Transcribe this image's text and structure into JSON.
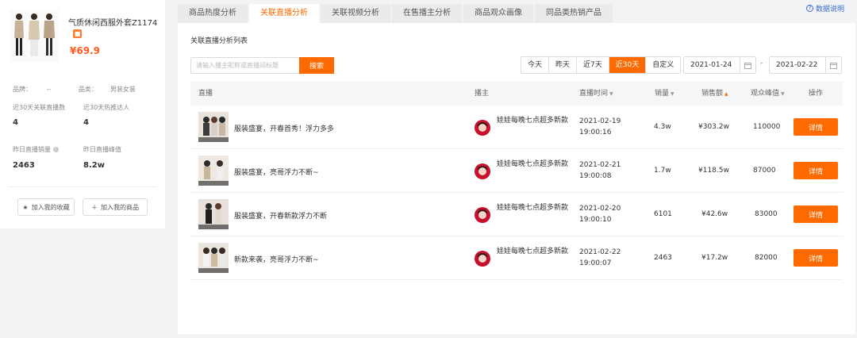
{
  "product": {
    "title": "气质休闲西服外套Z1174",
    "price": "¥69.9",
    "brand_label": "品牌：",
    "brand_value": "--",
    "category_label": "品类：",
    "category_value": "男装女装",
    "stats": [
      {
        "label": "近30天关联直播数",
        "value": "4"
      },
      {
        "label": "近30天热推达人",
        "value": "4"
      },
      {
        "label": "昨日直播销量",
        "value": "2463"
      },
      {
        "label": "昨日直播峰值",
        "value": "8.2w"
      }
    ],
    "favorite_label": "加入我的收藏",
    "add_product_label": "加入我的商品"
  },
  "tabs": [
    {
      "label": "商品热度分析",
      "active": false
    },
    {
      "label": "关联直播分析",
      "active": true
    },
    {
      "label": "关联视频分析",
      "active": false
    },
    {
      "label": "在售播主分析",
      "active": false
    },
    {
      "label": "商品观众画像",
      "active": false
    },
    {
      "label": "同品类热销产品",
      "active": false
    }
  ],
  "help_label": "数据说明",
  "section_title": "关联直播分析列表",
  "search": {
    "placeholder": "请输入播主昵称或直播间标题",
    "button": "搜索"
  },
  "ranges": [
    {
      "label": "今天",
      "active": false
    },
    {
      "label": "昨天",
      "active": false
    },
    {
      "label": "近7天",
      "active": false
    },
    {
      "label": "近30天",
      "active": true
    },
    {
      "label": "自定义",
      "active": false
    }
  ],
  "date_from": "2021-01-24",
  "date_to": "2021-02-22",
  "date_separator": "-",
  "columns": {
    "live": "直播",
    "anchor": "播主",
    "time": "直播时间",
    "sales": "销量",
    "revenue": "销售额",
    "peak": "观众峰值",
    "action": "操作"
  },
  "rows": [
    {
      "title": "服装盛宴，开春首秀！浮力多多",
      "anchor": "娃娃每晚七点超多新款",
      "date": "2021-02-19",
      "time": "19:00:16",
      "sales": "4.3w",
      "revenue": "¥303.2w",
      "peak": "110000",
      "action": "详情"
    },
    {
      "title": "服装盛宴，亮哥浮力不断~",
      "anchor": "娃娃每晚七点超多新款",
      "date": "2021-02-21",
      "time": "19:00:08",
      "sales": "1.7w",
      "revenue": "¥118.5w",
      "peak": "87000",
      "action": "详情"
    },
    {
      "title": "服装盛宴，开春新款浮力不断",
      "anchor": "娃娃每晚七点超多新款",
      "date": "2021-02-20",
      "time": "19:00:10",
      "sales": "6101",
      "revenue": "¥42.6w",
      "peak": "83000",
      "action": "详情"
    },
    {
      "title": "新款来袭，亮哥浮力不断~",
      "anchor": "娃娃每晚七点超多新款",
      "date": "2021-02-22",
      "time": "19:00:07",
      "sales": "2463",
      "revenue": "¥17.2w",
      "peak": "82000",
      "action": "详情"
    }
  ],
  "colors": {
    "accent": "#ff6a00",
    "price": "#ff5a1f",
    "link": "#3b6ccf"
  }
}
